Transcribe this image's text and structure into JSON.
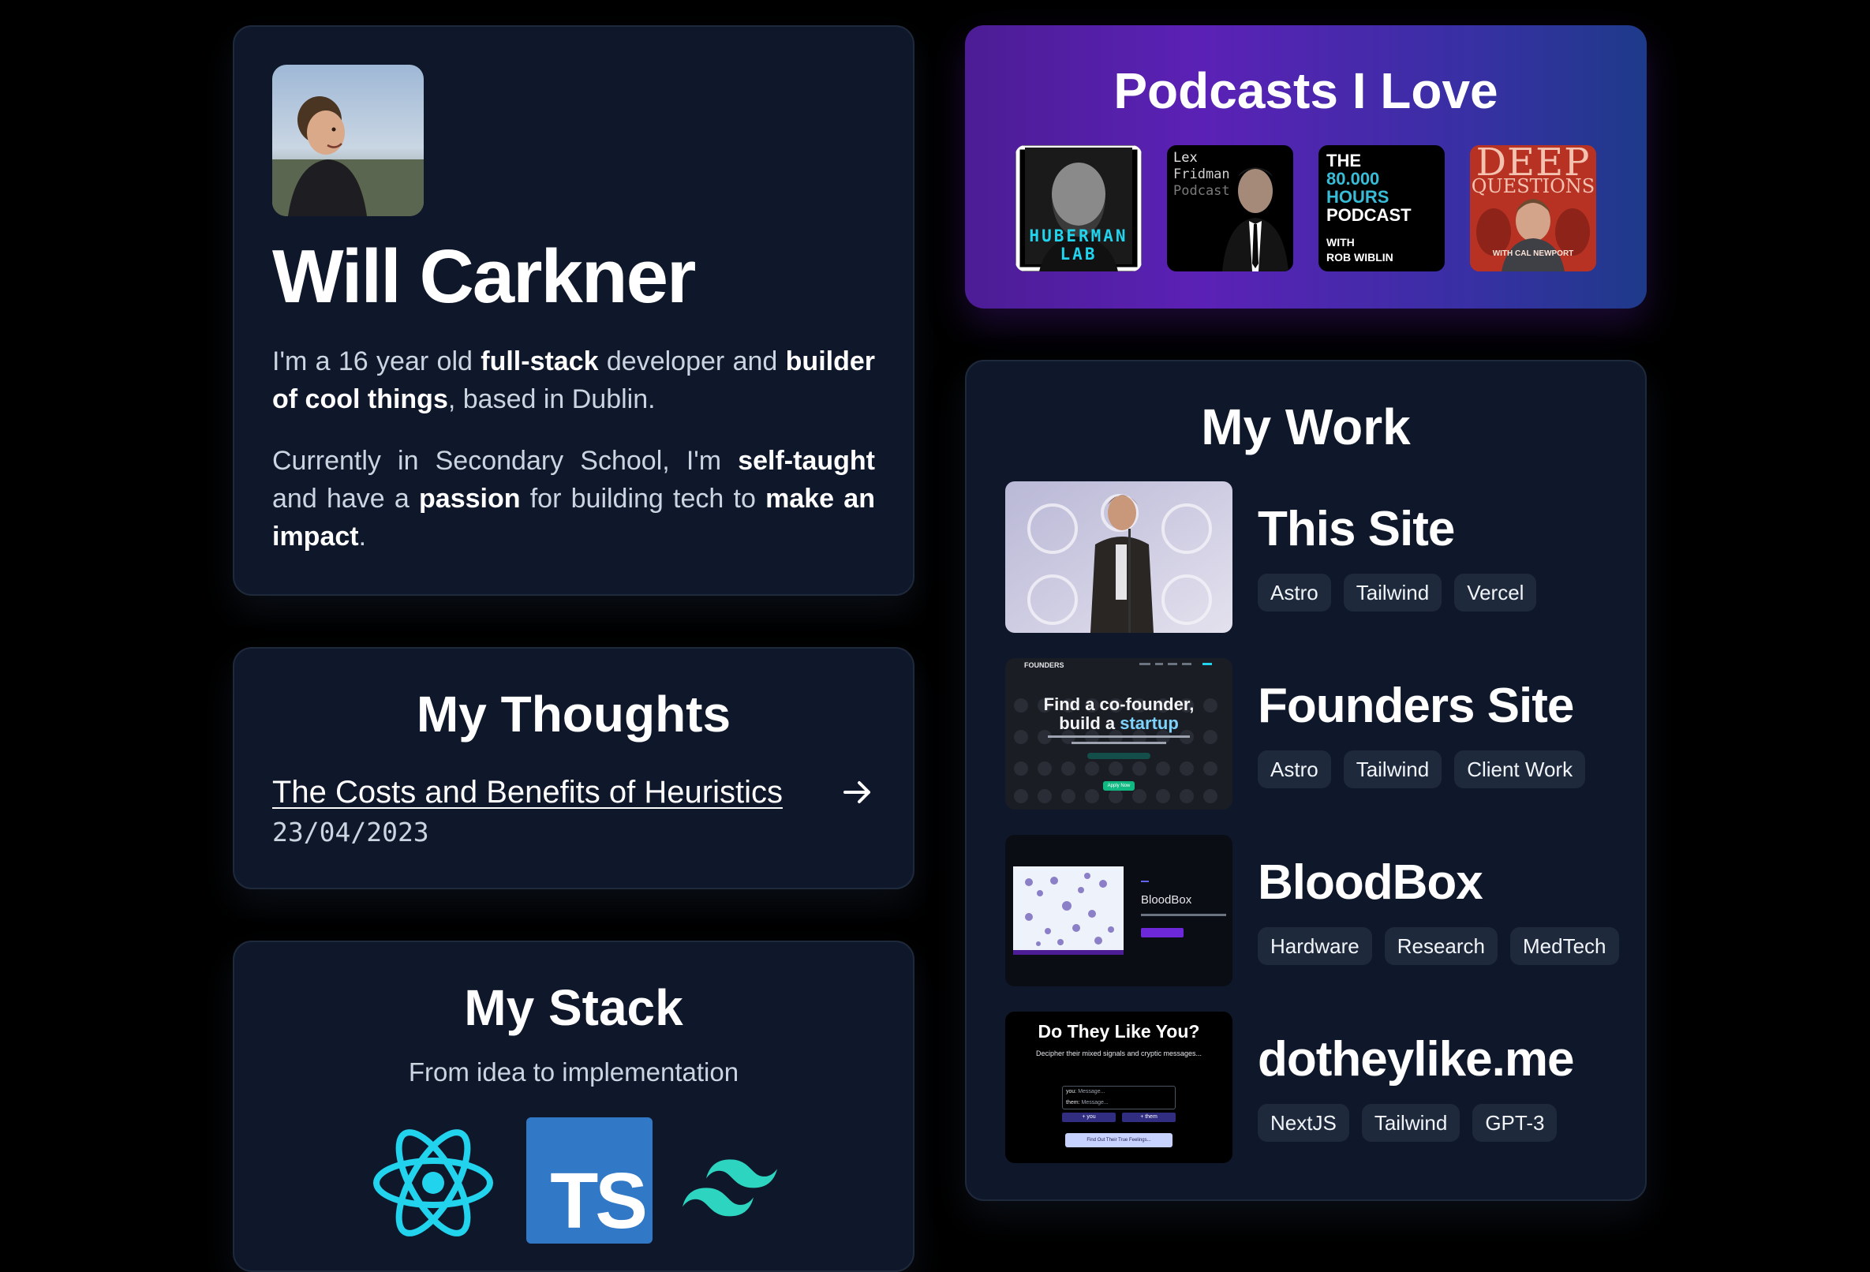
{
  "profile": {
    "name": "Will Carkner",
    "bio1": [
      {
        "t": "I'm a 16 year old ",
        "b": false
      },
      {
        "t": "full-stack",
        "b": true
      },
      {
        "t": " developer and ",
        "b": false
      },
      {
        "t": "builder of cool things",
        "b": true
      },
      {
        "t": ", based in Dublin.",
        "b": false
      }
    ],
    "bio2": [
      {
        "t": "Currently in Secondary School, I'm ",
        "b": false
      },
      {
        "t": "self-taught",
        "b": true
      },
      {
        "t": " and have a ",
        "b": false
      },
      {
        "t": "passion",
        "b": true
      },
      {
        "t": " for building tech to ",
        "b": false
      },
      {
        "t": "make an impact",
        "b": true
      },
      {
        "t": ".",
        "b": false
      }
    ]
  },
  "thoughts": {
    "title": "My Thoughts",
    "post_title": "The Costs and Benefits of Heuristics",
    "post_date": "23/04/2023"
  },
  "stack": {
    "title": "My Stack",
    "subtitle": "From idea to implementation",
    "icons": [
      "react-icon",
      "typescript-icon",
      "tailwind-icon"
    ],
    "ts_text": "TS"
  },
  "podcasts": {
    "title": "Podcasts I Love",
    "huberman": "HUBERMAN LAB",
    "lex": [
      "Lex",
      "Fridman",
      "Podcast"
    ],
    "hours": [
      "THE",
      "80.000",
      "HOURS",
      "PODCAST",
      "WITH",
      "ROB WIBLIN"
    ],
    "deep": [
      "DEEP",
      "QUESTIONS",
      "WITH CAL NEWPORT"
    ]
  },
  "work": {
    "title": "My Work",
    "projects": [
      {
        "title": "This Site",
        "tags": [
          "Astro",
          "Tailwind",
          "Vercel"
        ]
      },
      {
        "title": "Founders Site",
        "tags": [
          "Astro",
          "Tailwind",
          "Client Work"
        ],
        "thumb": {
          "brand": "FOUNDERS",
          "line1": "Find a co-founder,",
          "line2a": "build a ",
          "line2b": "startup",
          "cta": "Apply Now"
        }
      },
      {
        "title": "BloodBox",
        "tags": [
          "Hardware",
          "Research",
          "MedTech"
        ],
        "thumb": {
          "label": "BloodBox"
        }
      },
      {
        "title": "dotheylike.me",
        "tags": [
          "NextJS",
          "Tailwind",
          "GPT-3"
        ],
        "thumb": {
          "heading": "Do They Like You?",
          "sub": "Decipher their mixed signals and cryptic messages...",
          "you": "you:",
          "them": "them:",
          "placeholder": "Message...",
          "add_you": "+ you",
          "add_them": "+ them",
          "button": "Find Out Their True Feelings..."
        }
      }
    ]
  },
  "colors": {
    "background": "#000000",
    "card": "#0f172a",
    "tag": "#1e293b",
    "text_muted": "#cbd5e1",
    "podcast_gradient": [
      "#4c1d95",
      "#1e3a8a"
    ],
    "react": "#22d3ee",
    "typescript": "#3178c6",
    "tailwind": "#2dd4bf"
  }
}
